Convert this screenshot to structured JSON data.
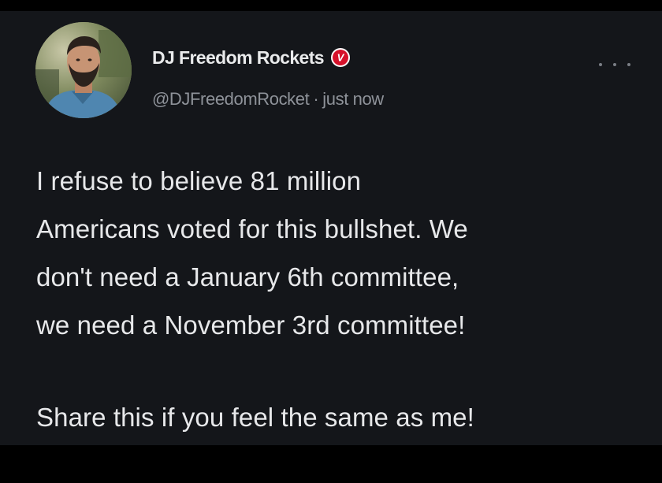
{
  "post": {
    "display_name": "DJ Freedom Rockets",
    "verified_badge": "verified-badge-icon",
    "verified_badge_letter": "V",
    "handle": "@DJFreedomRocket",
    "separator": "·",
    "timestamp": "just now",
    "more_icon": "more-options-icon",
    "body_lines": [
      "I refuse to believe 81 million",
      "Americans voted for this bullshet. We",
      "don't need a January 6th committee,",
      "we need a November 3rd committee!"
    ],
    "share_line": "Share this if you feel the same as me!"
  },
  "colors": {
    "background": "#000000",
    "card": "#14161a",
    "text_primary": "#e7e8ea",
    "text_secondary": "#8e9299",
    "badge_red": "#d6112a"
  }
}
